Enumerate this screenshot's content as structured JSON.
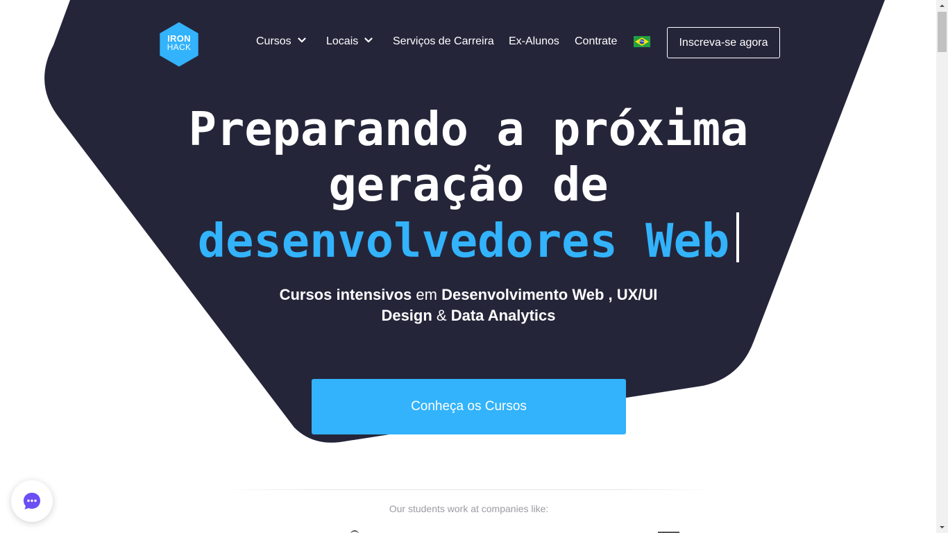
{
  "brand": {
    "logo_line1": "IRON",
    "logo_line2": "HACK",
    "logo_color": "#32b3fb",
    "accent_color": "#32b3fb",
    "dark_color": "#25253a"
  },
  "nav": {
    "items": [
      {
        "label": "Cursos",
        "has_dropdown": true
      },
      {
        "label": "Locais",
        "has_dropdown": true
      },
      {
        "label": "Serviços de Carreira",
        "has_dropdown": false
      },
      {
        "label": "Ex-Alunos",
        "has_dropdown": false
      },
      {
        "label": "Contrate",
        "has_dropdown": false
      }
    ],
    "language_flag": "brazil-flag-icon",
    "cta_label": "Inscreva-se agora"
  },
  "hero": {
    "headline_line1": "Preparando a próxima",
    "headline_line2": "geração de",
    "headline_highlight": "desenvolvedores Web",
    "subtitle": {
      "part1": "Cursos intensivos",
      "part2": " em ",
      "part3": "Desenvolvimento Web",
      "part4": " , ",
      "part5": "UX/UI Design",
      "part6": " & ",
      "part7": "Data Analytics"
    },
    "cta_label": "Conheça os Cursos"
  },
  "companies": {
    "label": "Our students work at companies like:"
  },
  "chat": {
    "icon": "chat-bubble-icon",
    "color": "#6c4ef5"
  }
}
